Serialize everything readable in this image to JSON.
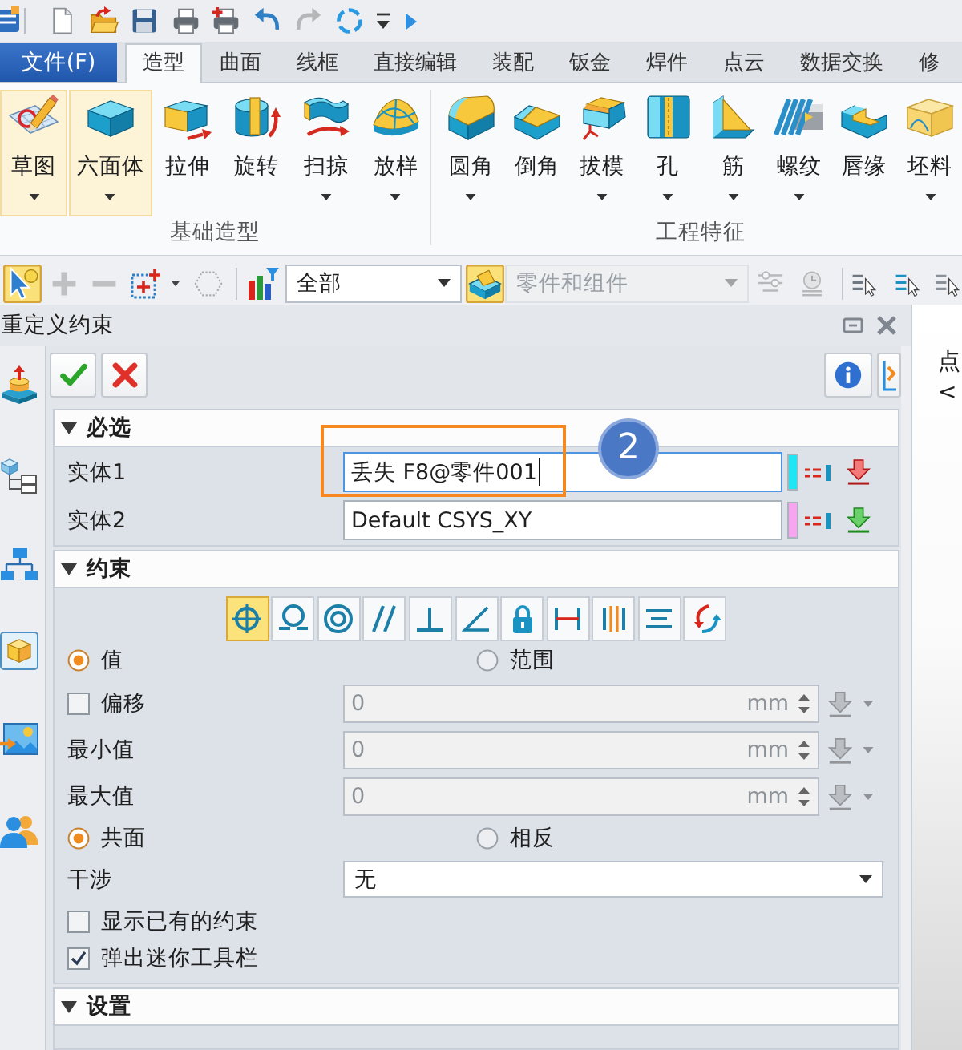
{
  "quick_access": {
    "tools": [
      {
        "disabled": false
      },
      {
        "disabled": false
      },
      {
        "disabled": false
      },
      {
        "disabled": false
      },
      {
        "disabled": false
      },
      {
        "disabled": false
      },
      {
        "disabled": true
      },
      {
        "disabled": false
      }
    ]
  },
  "ribbon": {
    "file_tab": "文件(F)",
    "tabs": [
      {
        "label": "造型",
        "selected": true
      },
      {
        "label": "曲面",
        "selected": false
      },
      {
        "label": "线框",
        "selected": false
      },
      {
        "label": "直接编辑",
        "selected": false
      },
      {
        "label": "装配",
        "selected": false
      },
      {
        "label": "钣金",
        "selected": false
      },
      {
        "label": "焊件",
        "selected": false
      },
      {
        "label": "点云",
        "selected": false
      },
      {
        "label": "数据交换",
        "selected": false
      },
      {
        "label": "修",
        "selected": false
      }
    ],
    "groups": [
      {
        "label": "基础造型",
        "buttons": [
          {
            "label": "草图",
            "dropdown": true,
            "highlighted": true
          },
          {
            "label": "六面体",
            "dropdown": true,
            "highlighted": true
          },
          {
            "label": "拉伸",
            "dropdown": false,
            "highlighted": false
          },
          {
            "label": "旋转",
            "dropdown": false,
            "highlighted": false
          },
          {
            "label": "扫掠",
            "dropdown": true,
            "highlighted": false
          },
          {
            "label": "放样",
            "dropdown": true,
            "highlighted": false
          }
        ]
      },
      {
        "label": "工程特征",
        "buttons": [
          {
            "label": "圆角",
            "dropdown": true,
            "highlighted": false
          },
          {
            "label": "倒角",
            "dropdown": false,
            "highlighted": false
          },
          {
            "label": "拔模",
            "dropdown": true,
            "highlighted": false
          },
          {
            "label": "孔",
            "dropdown": true,
            "highlighted": false
          },
          {
            "label": "筋",
            "dropdown": true,
            "highlighted": false
          },
          {
            "label": "螺纹",
            "dropdown": true,
            "highlighted": false
          },
          {
            "label": "唇缘",
            "dropdown": false,
            "highlighted": false
          },
          {
            "label": "坯料",
            "dropdown": true,
            "highlighted": false
          }
        ]
      }
    ]
  },
  "selection_toolbar": {
    "tools": [
      {
        "selected": true,
        "disabled": false
      },
      {
        "selected": false,
        "disabled": true
      },
      {
        "selected": false,
        "disabled": true
      },
      {
        "selected": false,
        "disabled": false
      },
      {
        "selected": false,
        "disabled": true
      },
      {
        "selected": false,
        "disabled": false
      }
    ],
    "filter": "全部",
    "scope_tool": {
      "selected": true
    },
    "scope": {
      "value": "零件和组件",
      "disabled": true
    },
    "extra_tools": [
      {
        "disabled": true
      },
      {
        "disabled": true
      },
      {
        "disabled": false
      },
      {
        "disabled": false
      },
      {
        "disabled": false
      }
    ]
  },
  "panel": {
    "title": "重定义约束",
    "required": {
      "title": "必选",
      "expanded": true,
      "entities": [
        {
          "label": "实体1",
          "value": "丢失 F8@零件001",
          "focused": true,
          "color": "#1fe6f2"
        },
        {
          "label": "实体2",
          "value": "Default CSYS_XY",
          "focused": false,
          "color": "#f6a5ee"
        }
      ]
    },
    "constraint": {
      "title": "约束",
      "expanded": true,
      "types": [
        {
          "selected": true
        },
        {
          "selected": false
        },
        {
          "selected": false
        },
        {
          "selected": false
        },
        {
          "selected": false
        },
        {
          "selected": false
        },
        {
          "selected": false
        },
        {
          "selected": false
        },
        {
          "selected": false
        },
        {
          "selected": false
        },
        {
          "selected": false
        }
      ],
      "mode": [
        {
          "label": "值",
          "selected": true
        },
        {
          "label": "范围",
          "selected": false
        }
      ],
      "value_rows": [
        {
          "kind": "checkbox",
          "label": "偏移",
          "checked": false,
          "value": "0",
          "unit": "mm",
          "disabled": true
        },
        {
          "kind": "plain",
          "label": "最小值",
          "value": "0",
          "unit": "mm",
          "disabled": true
        },
        {
          "kind": "plain",
          "label": "最大值",
          "value": "0",
          "unit": "mm",
          "disabled": true
        }
      ],
      "alignment": [
        {
          "label": "共面",
          "selected": true
        },
        {
          "label": "相反",
          "selected": false
        }
      ],
      "interference": {
        "label": "干涉",
        "value": "无"
      },
      "options": [
        {
          "label": "显示已有的约束",
          "checked": false
        },
        {
          "label": "弹出迷你工具栏",
          "checked": true
        }
      ]
    },
    "settings": {
      "title": "设置",
      "expanded": true
    }
  },
  "callout": {
    "badge": "2"
  },
  "side_panel": {
    "lines": [
      "点",
      "<"
    ]
  }
}
